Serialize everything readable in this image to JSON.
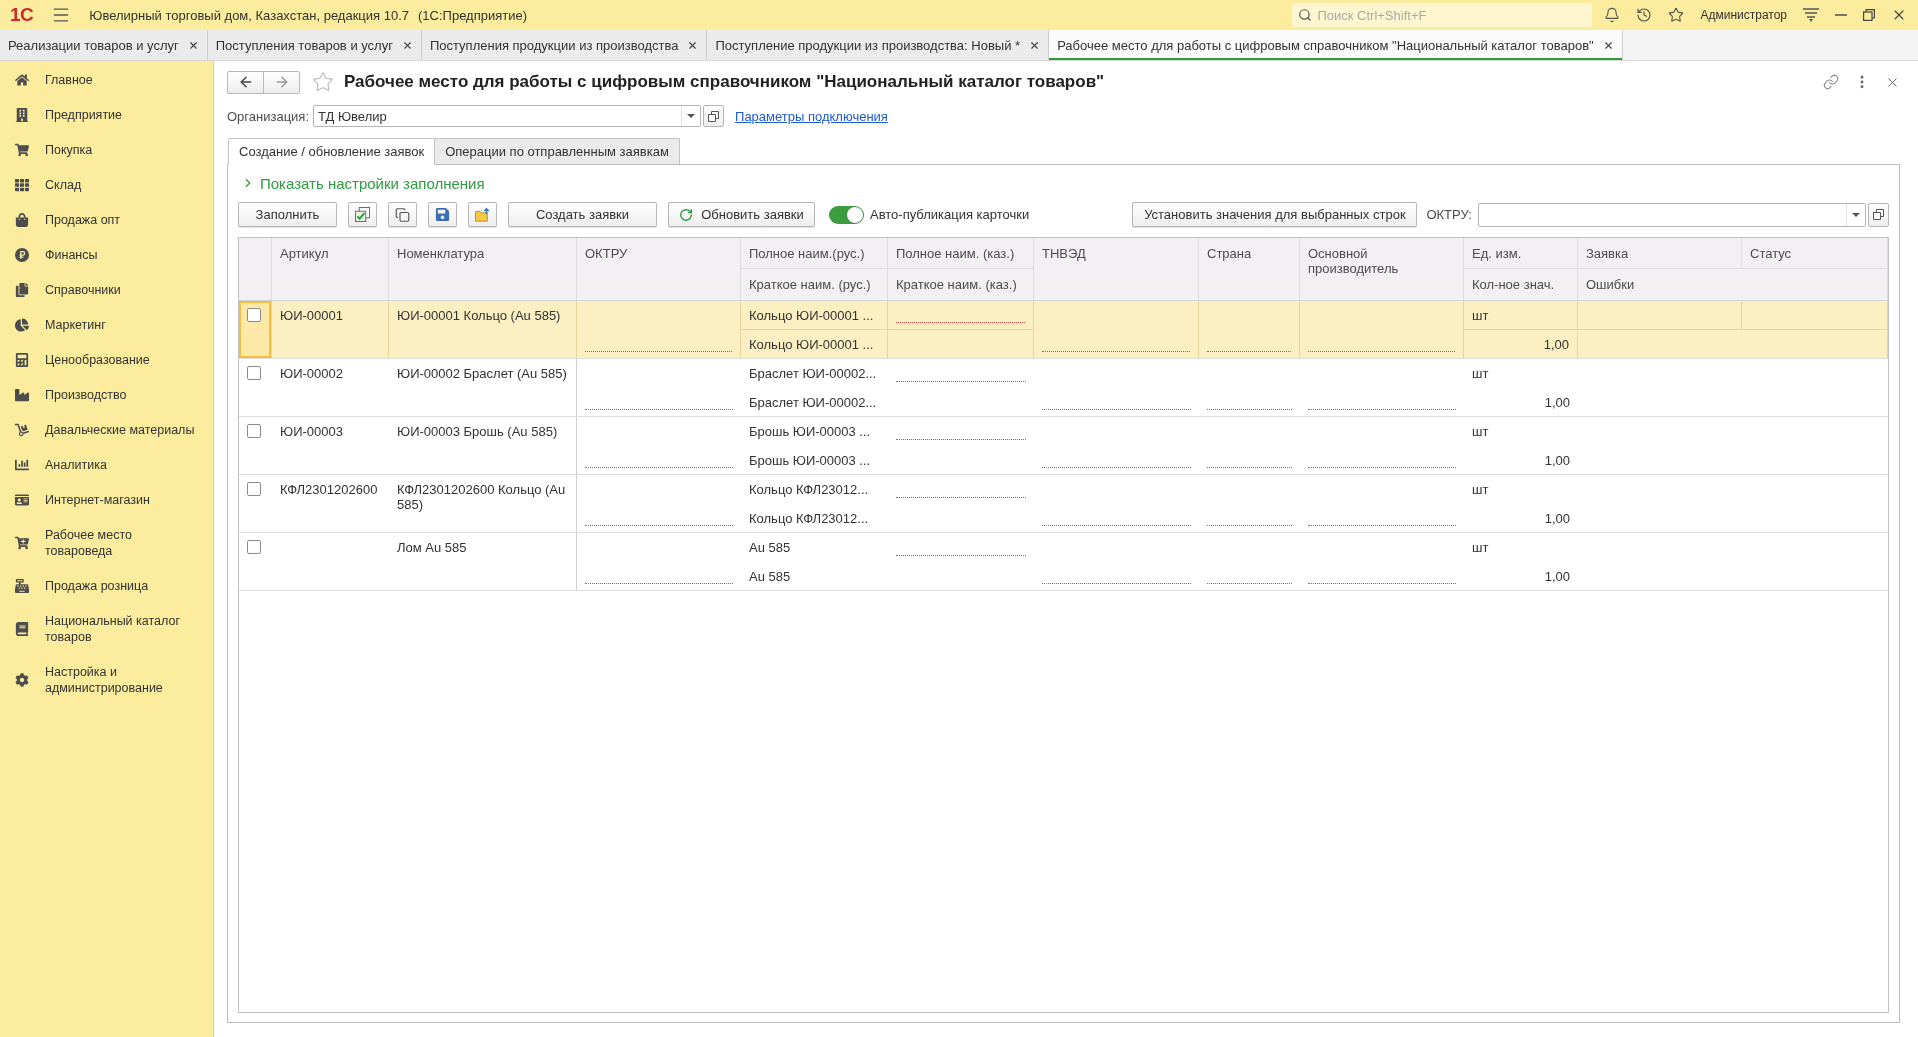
{
  "app_bar": {
    "logo": "1С",
    "title": "Ювелирный торговый дом, Казахстан, редакция 10.7",
    "platform": "(1С:Предприятие)",
    "search": {
      "placeholder": "Поиск Ctrl+Shift+F"
    },
    "user": "Администратор"
  },
  "open_tabs": [
    {
      "label": "Реализации товаров и услуг",
      "selected": false
    },
    {
      "label": "Поступления товаров и услуг",
      "selected": false
    },
    {
      "label": "Поступления продукции из производства",
      "selected": false
    },
    {
      "label": "Поступление продукции из производства: Новый *",
      "selected": false
    },
    {
      "label": "Рабочее место для работы с цифровым справочником \"Национальный каталог товаров\"",
      "selected": true
    }
  ],
  "sections": [
    "Главное",
    "Предприятие",
    "Покупка",
    "Склад",
    "Продажа опт",
    "Финансы",
    "Справочники",
    "Маркетинг",
    "Ценообразование",
    "Производство",
    "Давальческие материалы",
    "Аналитика",
    "Интернет-магазин",
    "Рабочее место товароведа",
    "Продажа розница",
    "Национальный каталог товаров",
    "Настройка и администрирование"
  ],
  "form": {
    "title": "Рабочее место для работы с цифровым справочником \"Национальный каталог товаров\"",
    "favorite": false,
    "organization": {
      "label": "Организация:",
      "value": "ТД Ювелир"
    },
    "connection_link": "Параметры подключения",
    "tabs": [
      {
        "label": "Создание / обновление заявок",
        "selected": true
      },
      {
        "label": "Операции по отправленным заявкам",
        "selected": false
      }
    ],
    "fill_settings": {
      "label": "Показать настройки заполнения",
      "expanded": false
    },
    "toolbar": {
      "fill_button": "Заполнить",
      "create_button": "Создать заявки",
      "refresh_button": "Обновить заявки",
      "auto_publish": {
        "label": "Авто-публикация карточки",
        "on": true
      },
      "set_values_button": "Установить значения для выбранных строк",
      "oktru_filter": {
        "label": "ОКТРУ:"
      }
    },
    "table": {
      "columns": [
        {
          "kind": "single",
          "label": "Артикул"
        },
        {
          "kind": "single",
          "label": "Номенклатура"
        },
        {
          "kind": "single",
          "label": "ОКТРУ",
          "required": true
        },
        {
          "kind": "pair",
          "label": "Полное наим.(рус.)",
          "sublabel": "Краткое наим. (рус.)"
        },
        {
          "kind": "pair",
          "label": "Полное наим. (каз.)",
          "sublabel": "Краткое наим. (каз.)",
          "required": true
        },
        {
          "kind": "single",
          "label": "ТНВЭД",
          "required": true
        },
        {
          "kind": "single",
          "label": "Страна",
          "required": true
        },
        {
          "kind": "single",
          "label": "Основной производитель",
          "required": true
        },
        {
          "kind": "pair",
          "label": "Ед. изм.",
          "sublabel": "Кол-ное знач."
        },
        {
          "kind": "split",
          "labels": [
            "Заявка",
            "Статус"
          ],
          "sublabel": "Ошибки"
        }
      ],
      "rows": [
        {
          "checked": false,
          "selected": true,
          "article": "ЮИ-00001",
          "name": "ЮИ-00001 Кольцо (Au 585)",
          "full_ru": "Кольцо ЮИ-00001 ...",
          "short_ru": "Кольцо ЮИ-00001 ...",
          "unit": "шт",
          "quantity": "1,00"
        },
        {
          "checked": false,
          "selected": false,
          "article": "ЮИ-00002",
          "name": "ЮИ-00002 Браслет (Au 585)",
          "full_ru": "Браслет ЮИ-00002...",
          "short_ru": "Браслет ЮИ-00002...",
          "unit": "шт",
          "quantity": "1,00"
        },
        {
          "checked": false,
          "selected": false,
          "article": "ЮИ-00003",
          "name": "ЮИ-00003 Брошь (Au 585)",
          "full_ru": "Брошь ЮИ-00003 ...",
          "short_ru": "Брошь ЮИ-00003 ...",
          "unit": "шт",
          "quantity": "1,00"
        },
        {
          "checked": false,
          "selected": false,
          "article": "КФЛ2301202600",
          "name": "КФЛ2301202600 Кольцо (Au 585)",
          "full_ru": "Кольцо КФЛ23012...",
          "short_ru": "Кольцо КФЛ23012...",
          "unit": "шт",
          "quantity": "1,00"
        },
        {
          "checked": false,
          "selected": false,
          "name": "Лом Au 585",
          "full_ru": "Au 585",
          "short_ru": "Au 585",
          "unit": "шт",
          "quantity": "1,00"
        }
      ]
    }
  }
}
